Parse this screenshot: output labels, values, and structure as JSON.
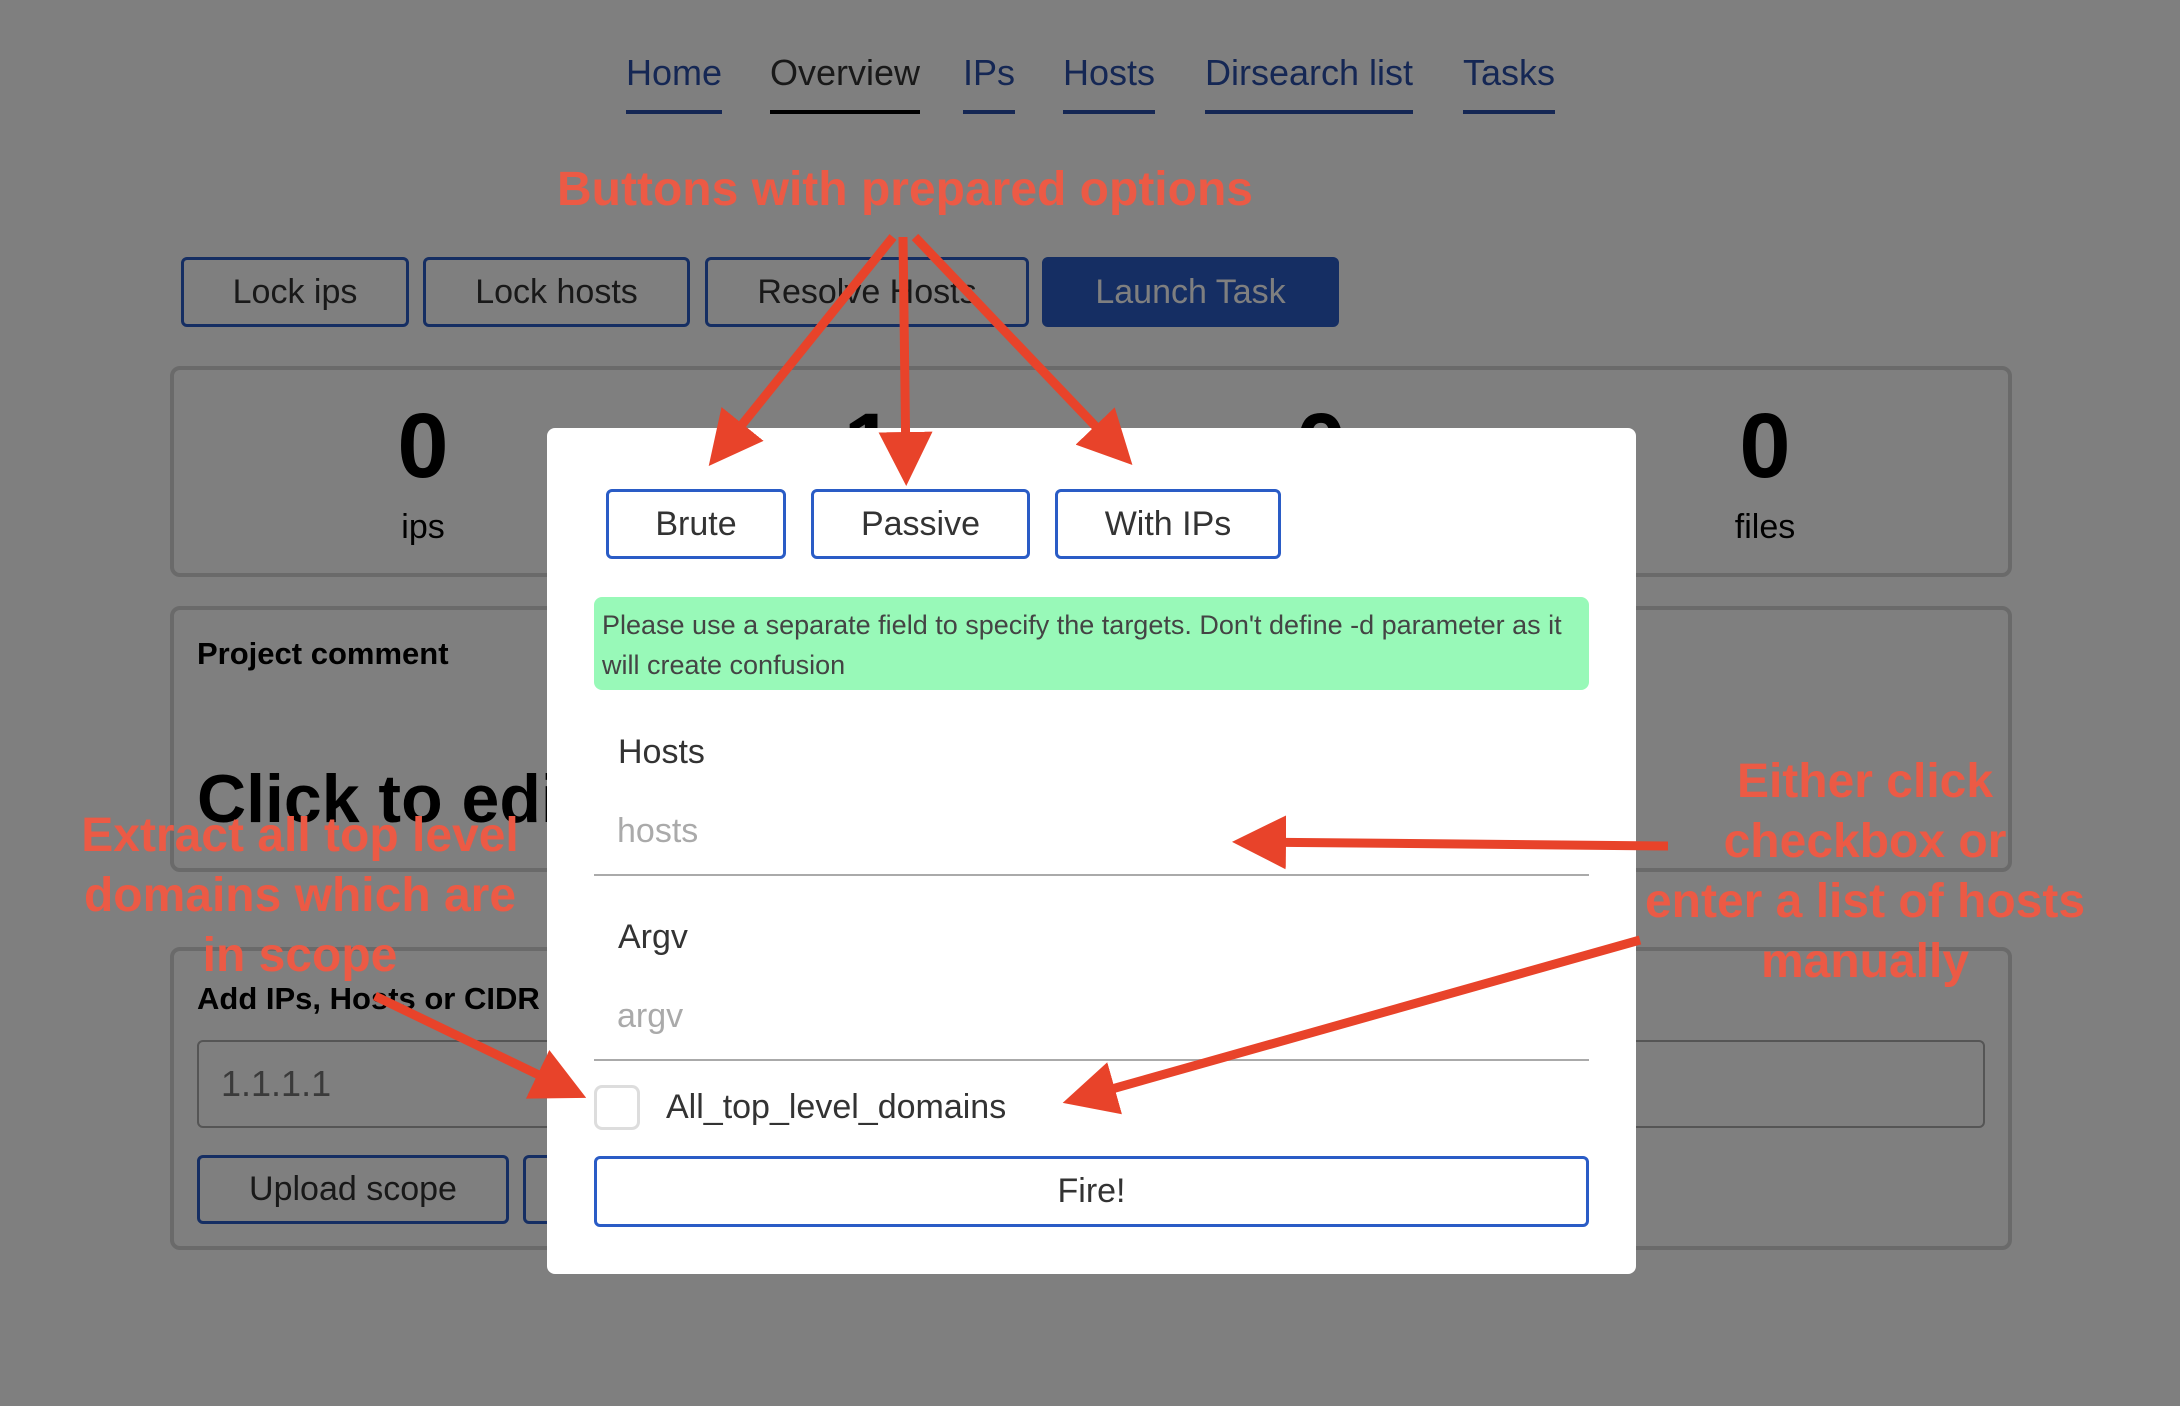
{
  "nav": {
    "items": [
      {
        "label": "Home",
        "active": false
      },
      {
        "label": "Overview",
        "active": true
      },
      {
        "label": "IPs",
        "active": false
      },
      {
        "label": "Hosts",
        "active": false
      },
      {
        "label": "Dirsearch list",
        "active": false
      },
      {
        "label": "Tasks",
        "active": false
      }
    ]
  },
  "toolbar": {
    "lock_ips": "Lock ips",
    "lock_hosts": "Lock hosts",
    "resolve_hosts": "Resolve Hosts",
    "launch_task": "Launch Task"
  },
  "stats": [
    {
      "value": "0",
      "label": "ips"
    },
    {
      "value": "1",
      "label": ""
    },
    {
      "value": "0",
      "label": ""
    },
    {
      "value": "0",
      "label": "files"
    }
  ],
  "project_comment": {
    "title": "Project comment",
    "body": "Click to edit"
  },
  "scope": {
    "title": "Add IPs, Hosts or CIDR s",
    "input_placeholder": "1.1.1.1",
    "upload_label": "Upload scope"
  },
  "modal": {
    "presets": [
      "Brute",
      "Passive",
      "With IPs"
    ],
    "notice": "Please use a separate field to specify the targets. Don't define -d parameter as it will create confusion",
    "hosts_label": "Hosts",
    "hosts_placeholder": "hosts",
    "argv_label": "Argv",
    "argv_placeholder": "argv",
    "checkbox_label": "All_top_level_domains",
    "checkbox_checked": false,
    "fire_label": "Fire!"
  },
  "annotations": {
    "presets_note": "Buttons with prepared options",
    "tld_note": [
      "Extract all top level",
      "domains which are",
      "in scope"
    ],
    "hosts_note": [
      "Either click",
      "checkbox or",
      "enter a list of hosts",
      "manually"
    ]
  },
  "colors": {
    "link": "#2a4fa8",
    "button_border": "#2a5cc6",
    "notice_bg": "#98f9b8",
    "annotation": "#ec5a45"
  }
}
